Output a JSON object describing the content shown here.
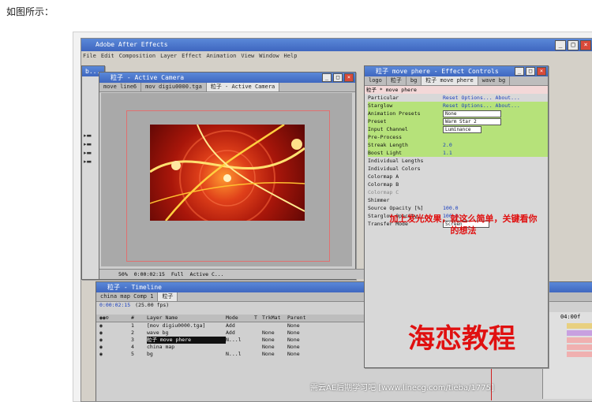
{
  "caption": "如图所示：",
  "app": {
    "title": "Adobe After Effects",
    "menu": [
      "File",
      "Edit",
      "Composition",
      "Layer",
      "Effect",
      "Animation",
      "View",
      "Window",
      "Help"
    ]
  },
  "project_panel": {
    "title": "b..."
  },
  "comp_viewer": {
    "title": "粒子 - Active Camera",
    "tabs": [
      "move line6",
      "mov digiu0000.tga",
      "粒子 - Active Camera"
    ],
    "zoom": "50%",
    "timecode": "0:00:02:15",
    "resolution": "Full",
    "view": "Active C..."
  },
  "effect_controls": {
    "title": "粒子 move phere - Effect Controls",
    "tabs": [
      "logo",
      "粒子",
      "bg",
      "粒子 move phere",
      "wave bg"
    ],
    "header": "粒子 * move phere",
    "rows": [
      {
        "label": "Particular",
        "value": "Reset Options... About...",
        "green": false
      },
      {
        "label": "Starglow",
        "value": "Reset Options... About...",
        "green": true
      },
      {
        "label": "Animation Presets",
        "value": "None",
        "green": true
      },
      {
        "label": "Preset",
        "value": "Warm Star 2",
        "green": true
      },
      {
        "label": "Input Channel",
        "value": "Luminance",
        "green": true
      },
      {
        "label": "Pre-Process",
        "value": "",
        "green": true
      },
      {
        "label": "Streak Length",
        "value": "2.0",
        "green": true
      },
      {
        "label": "Boost Light",
        "value": "1.1",
        "green": true
      },
      {
        "label": "Individual Lengths",
        "value": "",
        "green": false
      },
      {
        "label": "Individual Colors",
        "value": "",
        "green": false
      },
      {
        "label": "Colormap A",
        "value": "",
        "green": false
      },
      {
        "label": "Colormap B",
        "value": "",
        "green": false
      },
      {
        "label": "Colormap C",
        "value": "",
        "green": false
      },
      {
        "label": "Shimmer",
        "value": "",
        "green": false
      },
      {
        "label": "Source Opacity [%]",
        "value": "100.0",
        "green": false
      },
      {
        "label": "Starglow Opacity...",
        "value": "100.0",
        "green": false
      },
      {
        "label": "Transfer Mode",
        "value": "Screen",
        "green": false
      }
    ],
    "annotation": "加上发光效果，就这么简单，关键看你的想法"
  },
  "timeline": {
    "title": "粒子 - Timeline",
    "tabs": [
      "china map Comp 1",
      "粒子"
    ],
    "timecode": "0:00:02:15",
    "fps": "(25.00 fps)",
    "columns": [
      "#",
      "Layer Name",
      "Mode",
      "T",
      "TrkMat",
      "Parent"
    ],
    "time_marker": "04:00f",
    "layers": [
      {
        "num": "1",
        "name": "[mov digiu0000.tga]",
        "mode": "Add",
        "trkmat": "",
        "parent": "None",
        "color": "#e8d080"
      },
      {
        "num": "2",
        "name": "wave bg",
        "mode": "Add",
        "trkmat": "None",
        "parent": "None",
        "color": "#c8a0e0"
      },
      {
        "num": "3",
        "name": "粒子 move phere",
        "mode": "N...l",
        "trkmat": "None",
        "parent": "None",
        "color": "#e07070"
      },
      {
        "num": "4",
        "name": "china map",
        "mode": "",
        "trkmat": "None",
        "parent": "None",
        "color": "#e07070"
      },
      {
        "num": "5",
        "name": "bg",
        "mode": "N...l",
        "trkmat": "None",
        "parent": "None",
        "color": "#e07070"
      }
    ]
  },
  "watermark": "海恋教程",
  "footer_watermark": "需云AE后期学习吧 [www.linecg.com/tieba/1775]"
}
